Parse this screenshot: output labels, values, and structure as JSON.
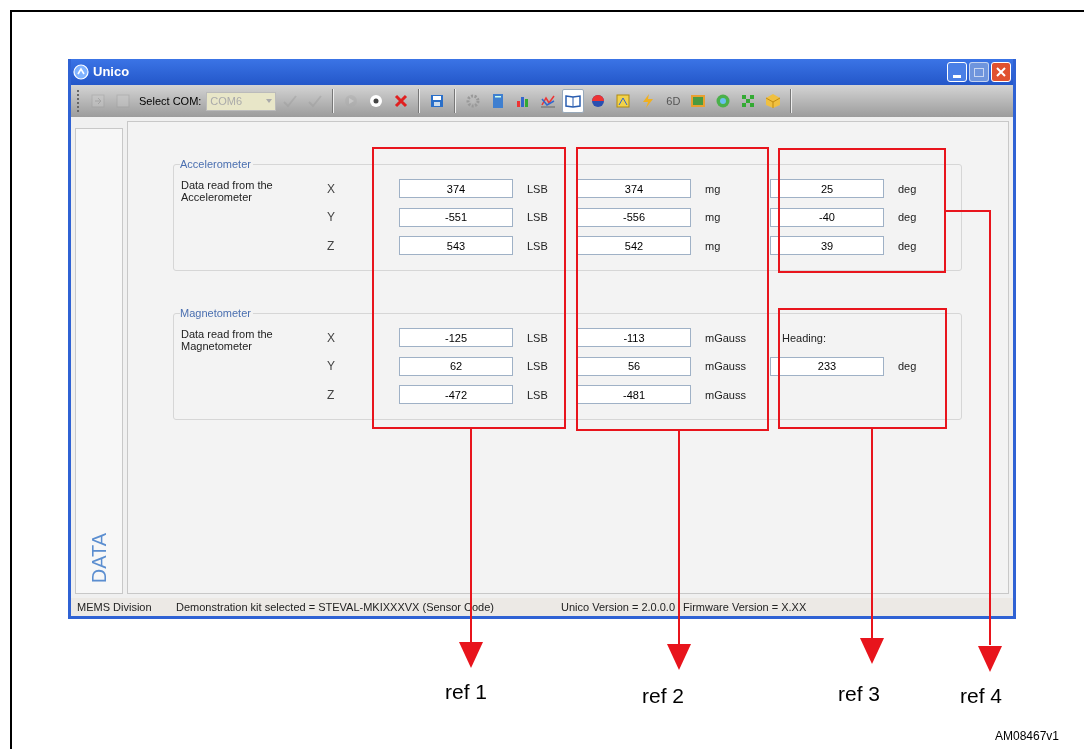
{
  "window": {
    "title": "Unico"
  },
  "toolbar": {
    "groups": [
      [
        {
          "kind": "icon",
          "disabled": true,
          "selected": false
        },
        {
          "kind": "icon",
          "disabled": true,
          "selected": false
        },
        {
          "kind": "label",
          "text": "Select COM:"
        },
        {
          "kind": "combo",
          "value": "COM6",
          "disabled": true
        },
        {
          "kind": "icon",
          "disabled": true,
          "selected": false
        },
        {
          "kind": "icon",
          "disabled": true,
          "selected": false
        }
      ],
      [
        {
          "kind": "icon",
          "disabled": true,
          "selected": false
        },
        {
          "kind": "icon",
          "disabled": false,
          "selected": false
        },
        {
          "kind": "icon",
          "disabled": false,
          "selected": false
        }
      ],
      [
        {
          "kind": "icon",
          "disabled": false,
          "selected": false
        }
      ],
      [
        {
          "kind": "icon",
          "disabled": false,
          "selected": false
        },
        {
          "kind": "icon",
          "disabled": false,
          "selected": false
        },
        {
          "kind": "icon",
          "disabled": false,
          "selected": false
        },
        {
          "kind": "icon",
          "disabled": false,
          "selected": false
        },
        {
          "kind": "icon",
          "disabled": false,
          "selected": true
        },
        {
          "kind": "icon",
          "disabled": false,
          "selected": false
        },
        {
          "kind": "icon",
          "disabled": false,
          "selected": false
        },
        {
          "kind": "icon",
          "disabled": false,
          "selected": false
        },
        {
          "kind": "text",
          "text": "6D",
          "disabled": false,
          "selected": false
        },
        {
          "kind": "icon",
          "disabled": false,
          "selected": false
        },
        {
          "kind": "icon",
          "disabled": false,
          "selected": false
        },
        {
          "kind": "icon",
          "disabled": false,
          "selected": false
        },
        {
          "kind": "icon",
          "disabled": false,
          "selected": false
        }
      ]
    ]
  },
  "sidebar": {
    "tabs": [
      {
        "label": "DATA",
        "selected": true
      }
    ]
  },
  "groups": [
    {
      "title": "Accelerometer",
      "description": "Data read from the Accelerometer",
      "kind": "angles",
      "rows": [
        {
          "axis": "X",
          "raw": "374",
          "raw_unit": "LSB",
          "converted": "374",
          "converted_unit": "mg",
          "angle": "25",
          "angle_unit": "deg"
        },
        {
          "axis": "Y",
          "raw": "-551",
          "raw_unit": "LSB",
          "converted": "-556",
          "converted_unit": "mg",
          "angle": "-40",
          "angle_unit": "deg"
        },
        {
          "axis": "Z",
          "raw": "543",
          "raw_unit": "LSB",
          "converted": "542",
          "converted_unit": "mg",
          "angle": "39",
          "angle_unit": "deg"
        }
      ]
    },
    {
      "title": "Magnetometer",
      "description": "Data read from the Magnetometer",
      "kind": "heading",
      "heading": {
        "label": "Heading:",
        "value": "233",
        "unit": "deg"
      },
      "rows": [
        {
          "axis": "X",
          "raw": "-125",
          "raw_unit": "LSB",
          "converted": "-113",
          "converted_unit": "mGauss"
        },
        {
          "axis": "Y",
          "raw": "62",
          "raw_unit": "LSB",
          "converted": "56",
          "converted_unit": "mGauss"
        },
        {
          "axis": "Z",
          "raw": "-472",
          "raw_unit": "LSB",
          "converted": "-481",
          "converted_unit": "mGauss"
        }
      ]
    }
  ],
  "status_bar": [
    "MEMS Division",
    "Demonstration kit selected = STEVAL-MKIXXXVX (Sensor Code)",
    "Unico Version = 2.0.0.0",
    "Firmware Version = X.XX"
  ],
  "annotations": [
    {
      "label": "ref 1"
    },
    {
      "label": "ref 2"
    },
    {
      "label": "ref 3"
    },
    {
      "label": "ref 4"
    }
  ],
  "figure_id": "AM08467v1"
}
